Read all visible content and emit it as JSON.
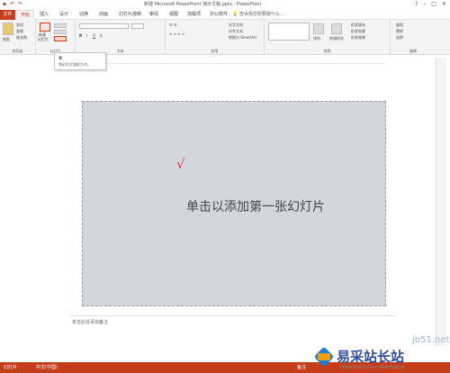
{
  "window": {
    "title": "新建 Microsoft PowerPoint 演示文稿.pptx - PowerPoint"
  },
  "ribbon_tabs": {
    "file": "文件",
    "home": "开始",
    "insert": "插入",
    "design": "设计",
    "transitions": "切换",
    "animations": "动画",
    "slideshow": "幻灯片放映",
    "review": "审阅",
    "view": "视图",
    "addins": "加载项",
    "office_tab": "办公软件",
    "tell_me": "告诉我您想要做什么..."
  },
  "ribbon_groups": {
    "clipboard": {
      "label": "剪贴板",
      "paste": "粘贴",
      "cut": "剪切",
      "copy": "复制",
      "format_painter": "格式刷"
    },
    "slides": {
      "label": "幻灯片",
      "new_slide_line1": "新建",
      "new_slide_line2": "幻灯片",
      "section": "节"
    },
    "font": {
      "label": "字体"
    },
    "paragraph": {
      "label": "段落",
      "text_direction": "文字方向",
      "align_text": "对齐文本",
      "smartart": "转换为 SmartArt"
    },
    "drawing": {
      "label": "绘图",
      "arrange": "排列",
      "quick_styles": "快速样式",
      "shape_fill": "形状填充",
      "shape_outline": "形状轮廓",
      "shape_effects": "形状效果"
    },
    "editing": {
      "label": "编辑",
      "find": "查找",
      "replace": "替换",
      "select": "选择"
    }
  },
  "tooltip": {
    "title": "节",
    "description": "将幻灯片组织为节。"
  },
  "slide": {
    "placeholder_text": "单击以添加第一张幻灯片",
    "annotation_mark": "√"
  },
  "notes": {
    "placeholder": "单击此处添加备注"
  },
  "status": {
    "slide_label": "幻灯片",
    "language": "中文(中国)",
    "notes_btn": "备注"
  },
  "watermark": {
    "top_text": "jb51.net",
    "brand_cn": "易采站长站",
    "brand_url": "Www.Easck.Com Webmaster"
  },
  "colors": {
    "accent": "#c43e1c",
    "slide_bg": "#d4d6dd",
    "checkmark": "#e53935"
  }
}
